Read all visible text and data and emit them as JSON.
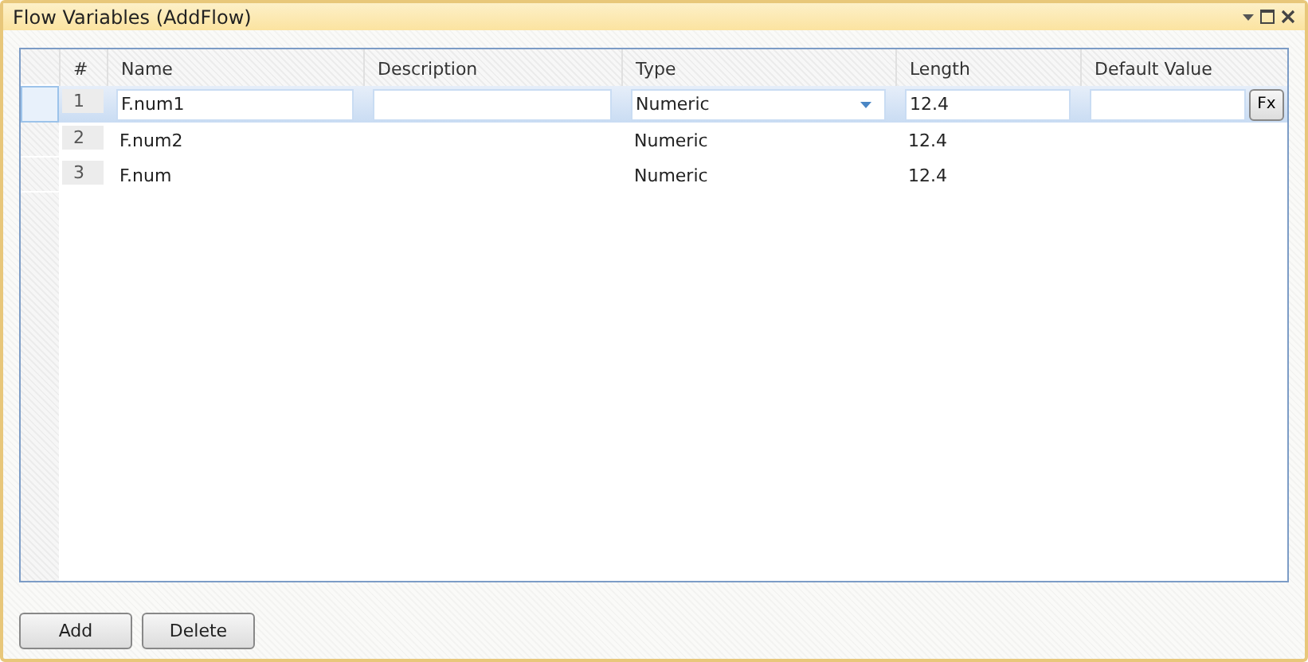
{
  "window": {
    "title": "Flow Variables (AddFlow)"
  },
  "table": {
    "columns": [
      "#",
      "Name",
      "Description",
      "Type",
      "Length",
      "Default Value"
    ],
    "rows": [
      {
        "number": "1",
        "name": "F.num1",
        "description": "",
        "type": "Numeric",
        "length": "12.4",
        "selected": true,
        "fx": "Fx"
      },
      {
        "number": "2",
        "name": "F.num2",
        "type": "Numeric",
        "length": "12.4",
        "selected": false
      },
      {
        "number": "3",
        "name": "F.num",
        "type": "Numeric",
        "length": "12.4",
        "selected": false
      }
    ]
  },
  "buttons": [
    "Add",
    "Delete"
  ]
}
